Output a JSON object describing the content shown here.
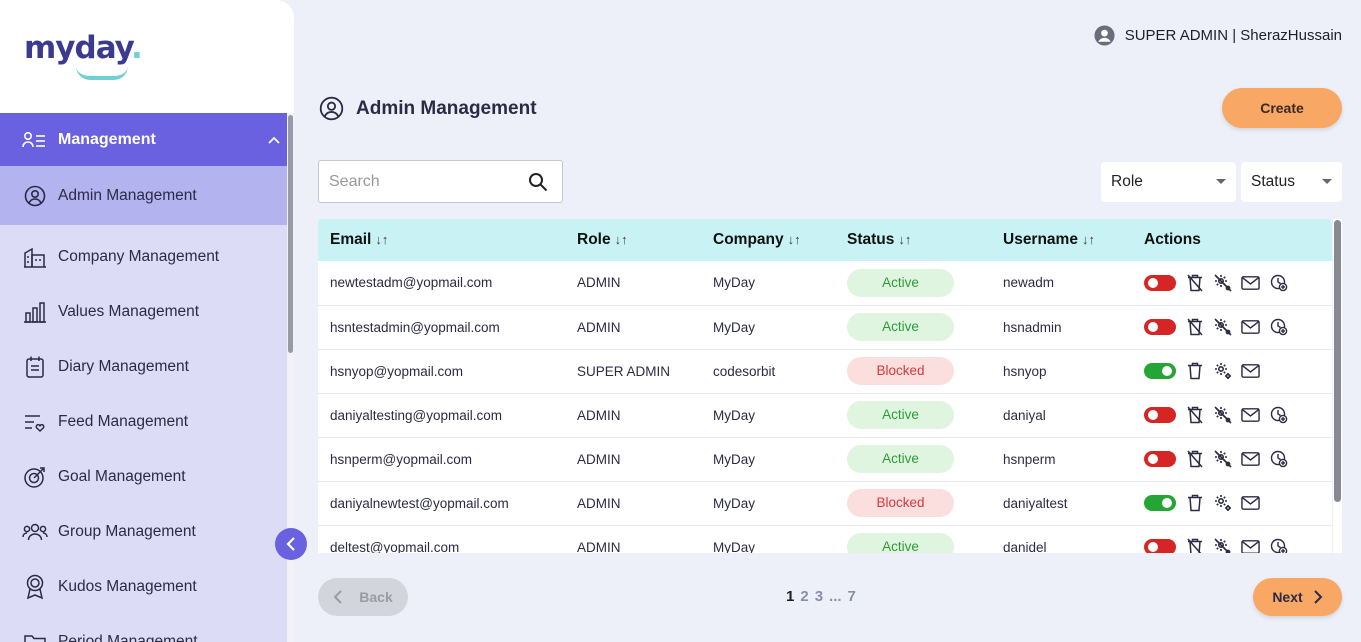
{
  "app": {
    "logo": "myday",
    "logo_dot": "."
  },
  "user": {
    "label": "SUPER ADMIN | SherazHussain"
  },
  "sidebar": {
    "section": "Management",
    "items": [
      {
        "label": "Admin Management",
        "icon": "user-circle-icon",
        "active": true
      },
      {
        "label": "Company Management",
        "icon": "building-icon"
      },
      {
        "label": "Values Management",
        "icon": "bar-chart-icon"
      },
      {
        "label": "Diary Management",
        "icon": "diary-icon"
      },
      {
        "label": "Feed Management",
        "icon": "feed-icon"
      },
      {
        "label": "Goal Management",
        "icon": "target-icon"
      },
      {
        "label": "Group Management",
        "icon": "group-icon"
      },
      {
        "label": "Kudos Management",
        "icon": "award-icon"
      },
      {
        "label": "Period Management",
        "icon": "folder-icon"
      }
    ]
  },
  "page": {
    "title": "Admin Management",
    "create_label": "Create"
  },
  "filters": {
    "search_placeholder": "Search",
    "role_label": "Role",
    "status_label": "Status"
  },
  "table": {
    "columns": [
      "Email",
      "Role",
      "Company",
      "Status",
      "Username",
      "Actions"
    ],
    "sort_glyph": "↓↑",
    "rows": [
      {
        "email": "newtestadm@yopmail.com",
        "role": "ADMIN",
        "company": "MyDay",
        "status": "Active",
        "username": "newadm",
        "enabled": false
      },
      {
        "email": "hsntestadmin@yopmail.com",
        "role": "ADMIN",
        "company": "MyDay",
        "status": "Active",
        "username": "hsnadmin",
        "enabled": false
      },
      {
        "email": "hsnyop@yopmail.com",
        "role": "SUPER ADMIN",
        "company": "codesorbit",
        "status": "Blocked",
        "username": "hsnyop",
        "enabled": true
      },
      {
        "email": "daniyaltesting@yopmail.com",
        "role": "ADMIN",
        "company": "MyDay",
        "status": "Active",
        "username": "daniyal",
        "enabled": false
      },
      {
        "email": "hsnperm@yopmail.com",
        "role": "ADMIN",
        "company": "MyDay",
        "status": "Active",
        "username": "hsnperm",
        "enabled": false
      },
      {
        "email": "daniyalnewtest@yopmail.com",
        "role": "ADMIN",
        "company": "MyDay",
        "status": "Blocked",
        "username": "daniyaltest",
        "enabled": true
      },
      {
        "email": "deltest@yopmail.com",
        "role": "ADMIN",
        "company": "MyDay",
        "status": "Active",
        "username": "danidel",
        "enabled": false
      }
    ]
  },
  "pagination": {
    "back_label": "Back",
    "next_label": "Next",
    "pages": [
      "1",
      "2",
      "3",
      "...",
      "7"
    ],
    "current": "1"
  },
  "colors": {
    "accent": "#6a61e0",
    "orange": "#f9a765",
    "header_teal": "#c8f2f3",
    "active_green": "#2e9b3a",
    "blocked_red": "#d63a3a"
  }
}
